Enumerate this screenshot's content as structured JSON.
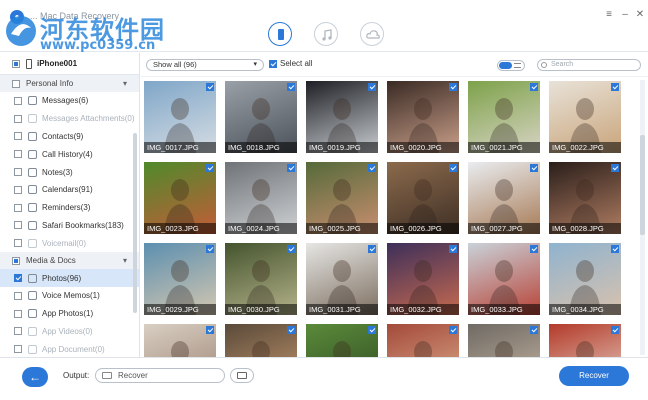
{
  "window": {
    "title": "... Mac Data Recovery"
  },
  "watermark": {
    "line1": "河东软件园",
    "line2": "www.pc0359.cn"
  },
  "modes": [
    {
      "icon": "phone-icon",
      "active": true
    },
    {
      "icon": "music-icon",
      "active": false
    },
    {
      "icon": "cloud-icon",
      "active": false
    }
  ],
  "device": {
    "name": "iPhone001"
  },
  "groups": [
    {
      "title": "Personal Info",
      "items": [
        {
          "label": "Messages(6)",
          "dim": false
        },
        {
          "label": "Messages Attachments(0)",
          "dim": true
        },
        {
          "label": "Contacts(9)",
          "dim": false
        },
        {
          "label": "Call History(4)",
          "dim": false
        },
        {
          "label": "Notes(3)",
          "dim": false
        },
        {
          "label": "Calendars(91)",
          "dim": false
        },
        {
          "label": "Reminders(3)",
          "dim": false
        },
        {
          "label": "Safari Bookmarks(183)",
          "dim": false
        },
        {
          "label": "Voicemail(0)",
          "dim": true
        }
      ]
    },
    {
      "title": "Media & Docs",
      "items": [
        {
          "label": "Photos(96)",
          "dim": false,
          "selected": true
        },
        {
          "label": "Voice Memos(1)",
          "dim": false
        },
        {
          "label": "App Photos(1)",
          "dim": false
        },
        {
          "label": "App Videos(0)",
          "dim": true
        },
        {
          "label": "App Document(0)",
          "dim": true
        }
      ]
    }
  ],
  "toolbar": {
    "filter": "Show all (96)",
    "select_all": "Select all",
    "search_placeholder": "Search"
  },
  "photos": [
    {
      "name": "IMG_0017.JPG",
      "c1": "#7fa6c8",
      "c2": "#d6dde3"
    },
    {
      "name": "IMG_0018.JPG",
      "c1": "#9aa0a8",
      "c2": "#4c525a"
    },
    {
      "name": "IMG_0019.JPG",
      "c1": "#1d1f24",
      "c2": "#c9cdd2"
    },
    {
      "name": "IMG_0020.JPG",
      "c1": "#3a2a24",
      "c2": "#caa08a"
    },
    {
      "name": "IMG_0021.JPG",
      "c1": "#7da24a",
      "c2": "#d8d4c4"
    },
    {
      "name": "IMG_0022.JPG",
      "c1": "#e8e2d8",
      "c2": "#c9a47a"
    },
    {
      "name": "IMG_0023.JPG",
      "c1": "#4f8a2c",
      "c2": "#c45c38"
    },
    {
      "name": "IMG_0024.JPG",
      "c1": "#6f7377",
      "c2": "#cfd2d5"
    },
    {
      "name": "IMG_0025.JPG",
      "c1": "#556a3a",
      "c2": "#c98f70"
    },
    {
      "name": "IMG_0026.JPG",
      "c1": "#8b6a4c",
      "c2": "#3e2f25"
    },
    {
      "name": "IMG_0027.JPG",
      "c1": "#e9ecef",
      "c2": "#a77a55"
    },
    {
      "name": "IMG_0028.JPG",
      "c1": "#2a1e1a",
      "c2": "#b07d62"
    },
    {
      "name": "IMG_0029.JPG",
      "c1": "#5c8fb0",
      "c2": "#d4c7b0"
    },
    {
      "name": "IMG_0030.JPG",
      "c1": "#44542e",
      "c2": "#b5b38a"
    },
    {
      "name": "IMG_0031.JPG",
      "c1": "#e6e6e4",
      "c2": "#7d6f60"
    },
    {
      "name": "IMG_0032.JPG",
      "c1": "#3d2f5a",
      "c2": "#c76a4f"
    },
    {
      "name": "IMG_0033.JPG",
      "c1": "#c9d2d9",
      "c2": "#b84236"
    },
    {
      "name": "IMG_0034.JPG",
      "c1": "#8fb3cf",
      "c2": "#d9c2ad"
    },
    {
      "name": "",
      "c1": "#d8cfc2",
      "c2": "#9a8070"
    },
    {
      "name": "",
      "c1": "#5a4a3a",
      "c2": "#c89a70"
    },
    {
      "name": "",
      "c1": "#5a8a3a",
      "c2": "#2e4a22"
    },
    {
      "name": "",
      "c1": "#a34a3a",
      "c2": "#e0b090"
    },
    {
      "name": "",
      "c1": "#6f6a64",
      "c2": "#c9b8a4"
    },
    {
      "name": "",
      "c1": "#b33a2a",
      "c2": "#e8d6c8"
    }
  ],
  "bottom": {
    "output_label": "Output:",
    "output_path": "Recover",
    "recover_label": "Recover"
  },
  "colors": {
    "accent": "#2b78d8"
  }
}
